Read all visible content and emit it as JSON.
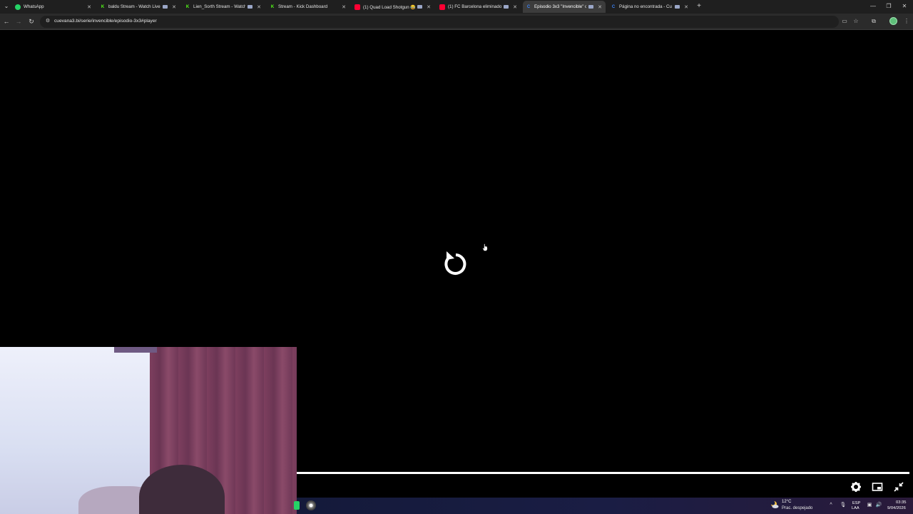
{
  "browser": {
    "tabs": [
      {
        "title": "WhatsApp",
        "favicon": "whatsapp-icon",
        "color": "#25d366",
        "active": false,
        "media": false
      },
      {
        "title": "baldu Stream - Watch Live",
        "favicon": "kick-icon",
        "color": "#53fc18",
        "active": false,
        "media": true
      },
      {
        "title": "Lien_Sorth Stream - Watch Live",
        "favicon": "kick-icon",
        "color": "#53fc18",
        "active": false,
        "media": true
      },
      {
        "title": "Stream - Kick Dashboard",
        "favicon": "kick-icon",
        "color": "#53fc18",
        "active": false,
        "media": false
      },
      {
        "title": "(1) Quad Load Shotgun 😂 (",
        "favicon": "youtube-icon",
        "color": "#ff0033",
        "active": false,
        "media": true
      },
      {
        "title": "(1) FC Barcelona eliminado",
        "favicon": "youtube-icon",
        "color": "#ff0033",
        "active": false,
        "media": true
      },
      {
        "title": "Episodio 3x3 \"Invencible\" o",
        "favicon": "cuevana-icon",
        "color": "#3b82f6",
        "active": true,
        "media": true
      },
      {
        "title": "Página no encontrada - Cu",
        "favicon": "cuevana-icon",
        "color": "#3b82f6",
        "active": false,
        "media": true
      }
    ],
    "url": "cuevana3.bi/serie/invencible/episodio-3x3#player"
  },
  "player": {
    "progress_fraction": 1.0
  },
  "taskbar": {
    "weather_temp": "12°C",
    "weather_desc": "Prac. despejado",
    "lang_code": "ESP",
    "lang_region": "LAA",
    "time": "03:35",
    "date": "9/04/2026"
  }
}
